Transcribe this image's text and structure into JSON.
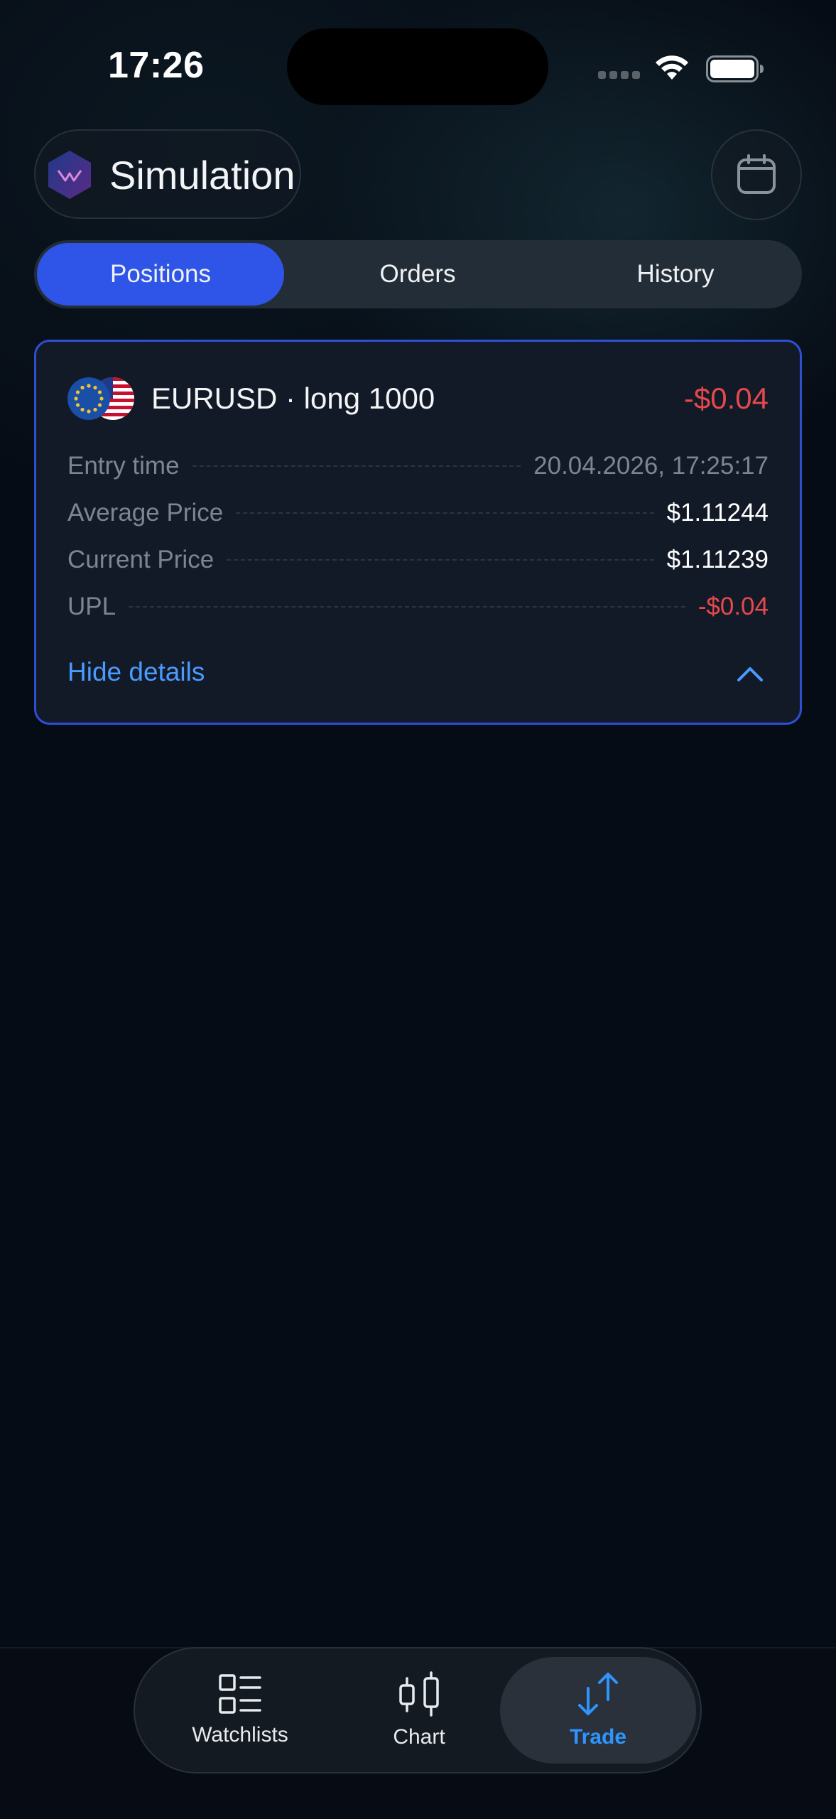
{
  "status_bar": {
    "time": "17:26"
  },
  "header": {
    "title": "Simulation"
  },
  "tabs": [
    {
      "label": "Positions",
      "active": true
    },
    {
      "label": "Orders",
      "active": false
    },
    {
      "label": "History",
      "active": false
    }
  ],
  "position": {
    "title": "EURUSD · long 1000",
    "pnl": "-$0.04",
    "rows": [
      {
        "label": "Entry time",
        "value": "20.04.2026, 17:25:17"
      },
      {
        "label": "Average Price",
        "value": "$1.11244"
      },
      {
        "label": "Current Price",
        "value": "$1.11239"
      },
      {
        "label": "UPL",
        "value": "-$0.04"
      }
    ],
    "toggle_label": "Hide details"
  },
  "nav": [
    {
      "label": "Watchlists",
      "icon": "watchlists-icon",
      "active": false
    },
    {
      "label": "Chart",
      "icon": "candlestick-icon",
      "active": false
    },
    {
      "label": "Trade",
      "icon": "trade-arrows-icon",
      "active": true
    }
  ],
  "colors": {
    "accent": "#2f54e8",
    "negative": "#e5484d",
    "link": "#4a9bff",
    "nav_active": "#2e95ff"
  }
}
